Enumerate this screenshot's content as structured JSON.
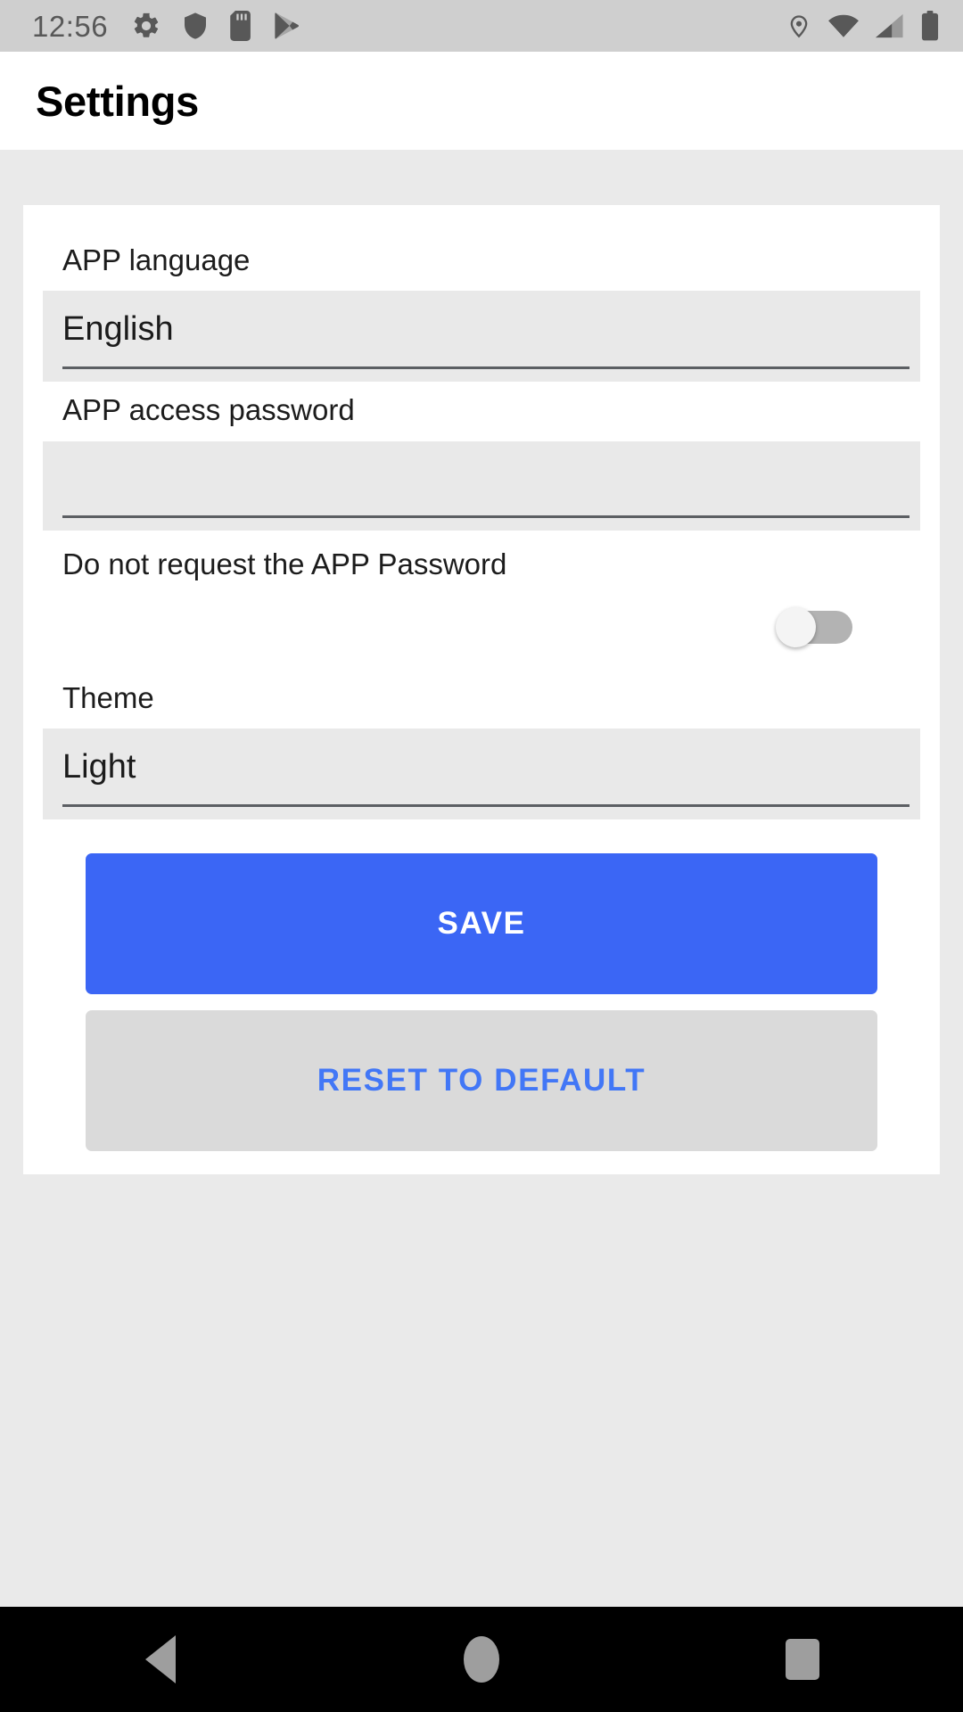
{
  "status_bar": {
    "time": "12:56",
    "left_icons": [
      "gear-icon",
      "shield-icon",
      "sd-card-icon",
      "play-store-icon"
    ],
    "right_icons": [
      "location-pin-icon",
      "wifi-icon",
      "cellular-signal-icon",
      "battery-icon"
    ],
    "background": "#cfcfcf",
    "icon_color": "#585858"
  },
  "app_bar": {
    "title": "Settings",
    "background": "#ffffff"
  },
  "settings": {
    "language": {
      "label": "APP language",
      "value": "English"
    },
    "password": {
      "label": "APP access password",
      "value": "",
      "placeholder": ""
    },
    "no_password_request": {
      "label": "Do not request the APP Password",
      "enabled": false,
      "toggle_state": "off"
    },
    "theme": {
      "label": "Theme",
      "value": "Light"
    }
  },
  "buttons": {
    "save_label": "SAVE",
    "save_color": "#3b66f5",
    "save_text_color": "#ffffff",
    "reset_label": "RESET TO DEFAULT",
    "reset_color": "#dadada",
    "reset_text_color": "#4277f6"
  },
  "nav_bar": {
    "background": "#000000",
    "items": [
      "back-button",
      "home-button",
      "recents-button"
    ]
  },
  "colors": {
    "page_background": "#eaeaea",
    "card_background": "#ffffff",
    "field_background": "#e9e9e9",
    "field_underline": "#5c5f63",
    "accent": "#3b66f5"
  }
}
